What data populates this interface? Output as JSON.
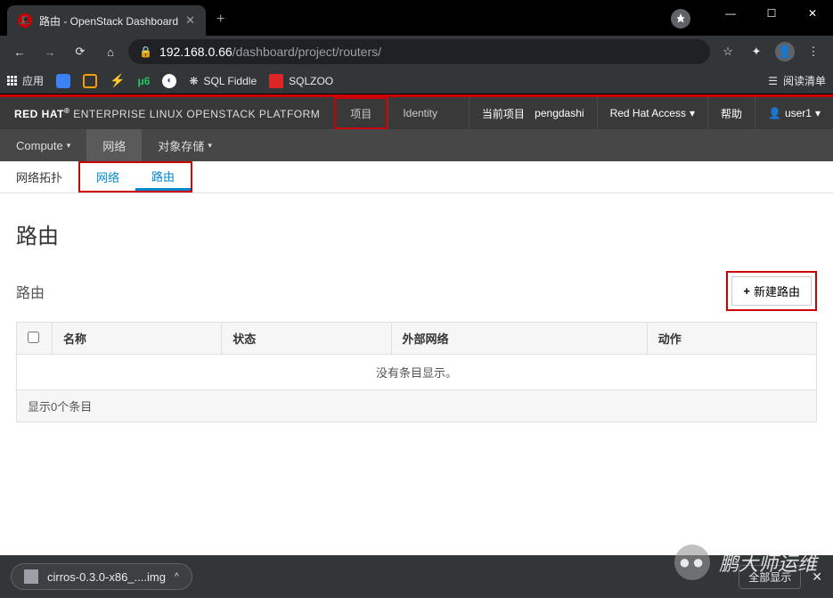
{
  "browser": {
    "tab_title": "路由 - OpenStack Dashboard",
    "url_host": "192.168.0.66",
    "url_path": "/dashboard/project/routers/"
  },
  "bookmarks": {
    "apps": "应用",
    "items": [
      "SQL Fiddle",
      "SQLZOO"
    ],
    "reading_list": "阅读清单"
  },
  "brand": {
    "red_hat": "RED HAT",
    "rest": " ENTERPRISE LINUX OPENSTACK PLATFORM"
  },
  "topnav": {
    "project": "项目",
    "identity": "Identity"
  },
  "topright": {
    "current_project_label": "当前项目",
    "current_project_value": "pengdashi",
    "access": "Red Hat Access",
    "help": "帮助",
    "user": "user1"
  },
  "subnav": {
    "compute": "Compute",
    "network": "网络",
    "object_storage": "对象存储"
  },
  "tabs": {
    "topology": "网络拓扑",
    "networks": "网络",
    "routers": "路由"
  },
  "page": {
    "title": "路由",
    "panel_title": "路由",
    "new_router": "新建路由"
  },
  "table": {
    "columns": {
      "name": "名称",
      "status": "状态",
      "ext_net": "外部网络",
      "actions": "动作"
    },
    "empty": "没有条目显示。",
    "footer": "显示0个条目"
  },
  "download": {
    "filename": "cirros-0.3.0-x86_....img",
    "show_all": "全部显示"
  },
  "watermark": "鹏大师运维"
}
